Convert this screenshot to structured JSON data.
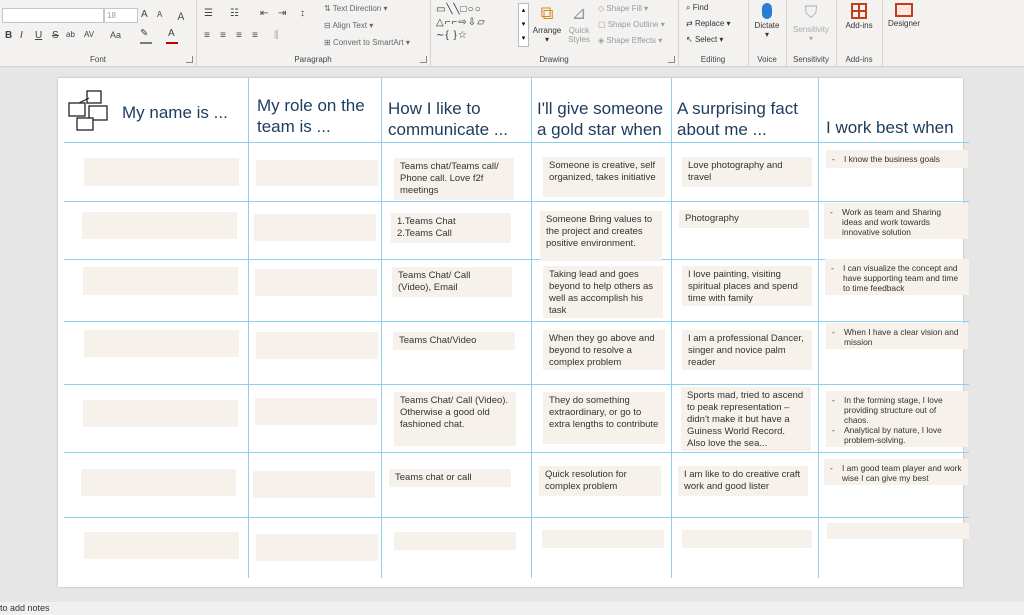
{
  "ribbon": {
    "font": {
      "label": "Font",
      "size": "18",
      "bold": "B",
      "italic": "I",
      "underline": "U",
      "strike": "S",
      "shadow": "ab",
      "spacing": "AV",
      "case": "Aa",
      "grow": "A",
      "shrink": "A"
    },
    "paragraph": {
      "label": "Paragraph",
      "text_direction": "Text Direction",
      "align_text": "Align Text",
      "convert_smartart": "Convert to SmartArt"
    },
    "drawing": {
      "label": "Drawing",
      "arrange": "Arrange",
      "quick_styles": "Quick Styles",
      "shape_fill": "Shape Fill",
      "shape_outline": "Shape Outline",
      "shape_effects": "Shape Effects"
    },
    "editing": {
      "label": "Editing",
      "find": "Find",
      "replace": "Replace",
      "select": "Select"
    },
    "voice": {
      "label": "Voice",
      "dictate": "Dictate"
    },
    "sensitivity": {
      "label": "Sensitivity",
      "button": "Sensitivity"
    },
    "addins": {
      "label": "Add-ins",
      "button": "Add-ins"
    },
    "designer": {
      "button": "Designer"
    }
  },
  "slide": {
    "headers": [
      "My name is ...",
      "My role on the team is ...",
      "How I like to communicate ...",
      "I'll give someone a gold star when",
      "A surprising fact about me ...",
      "I work best when"
    ],
    "rows": [
      {
        "communicate": "Teams chat/Teams call/ Phone call. Love f2f meetings",
        "gold_star": "Someone is creative, self organized, takes initiative",
        "fact": "Love photography and travel",
        "work_best": [
          "I know the business goals"
        ]
      },
      {
        "communicate": "1.Teams Chat\n2.Teams Call",
        "gold_star": "Someone Bring values to the project and creates positive environment.",
        "fact": "Photography",
        "work_best": [
          "Work as team and Sharing ideas and work towards innovative solution"
        ]
      },
      {
        "communicate": "Teams Chat/ Call (Video), Email",
        "gold_star": "Taking lead and goes beyond to help others as well as accomplish his task",
        "fact": "I love painting, visiting spiritual places and spend time with family",
        "work_best": [
          "I can visualize the concept and have supporting team and time to time feedback"
        ]
      },
      {
        "communicate": "Teams Chat/Video",
        "gold_star": "When they go above and beyond to resolve a complex problem",
        "fact": "I am a professional Dancer, singer and novice palm reader",
        "work_best": [
          "When I have a clear vision and mission"
        ]
      },
      {
        "communicate": "Teams Chat/ Call (Video). Otherwise a good old fashioned chat.",
        "gold_star": "They do something extraordinary, or go to extra lengths to contribute",
        "fact": "Sports mad, tried to ascend to peak representation – didn't make it but have a Guiness World Record. Also love the sea...",
        "work_best": [
          "In the forming stage, I love providing structure out of chaos.",
          "Analytical by nature, I love problem-solving."
        ]
      },
      {
        "communicate": "Teams chat or call",
        "gold_star": "Quick resolution for complex problem",
        "fact": "I am like to do creative craft work and good lister",
        "work_best": [
          "I am good team player and work wise I can give my best"
        ]
      }
    ]
  },
  "status": {
    "notes": "Click to add notes"
  }
}
